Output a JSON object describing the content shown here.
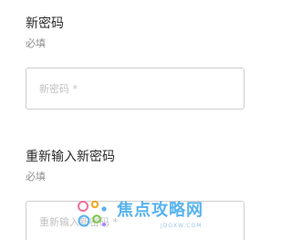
{
  "new_password": {
    "label": "新密码",
    "hint": "必填",
    "placeholder": "新密码 *"
  },
  "confirm_password": {
    "label": "重新输入新密码",
    "hint": "必填",
    "placeholder": "重新输入新密码 *"
  },
  "watermark": {
    "logo_icon": "colored-dots-icon",
    "text": "焦点攻略网",
    "url": "JDGXW.COM"
  }
}
